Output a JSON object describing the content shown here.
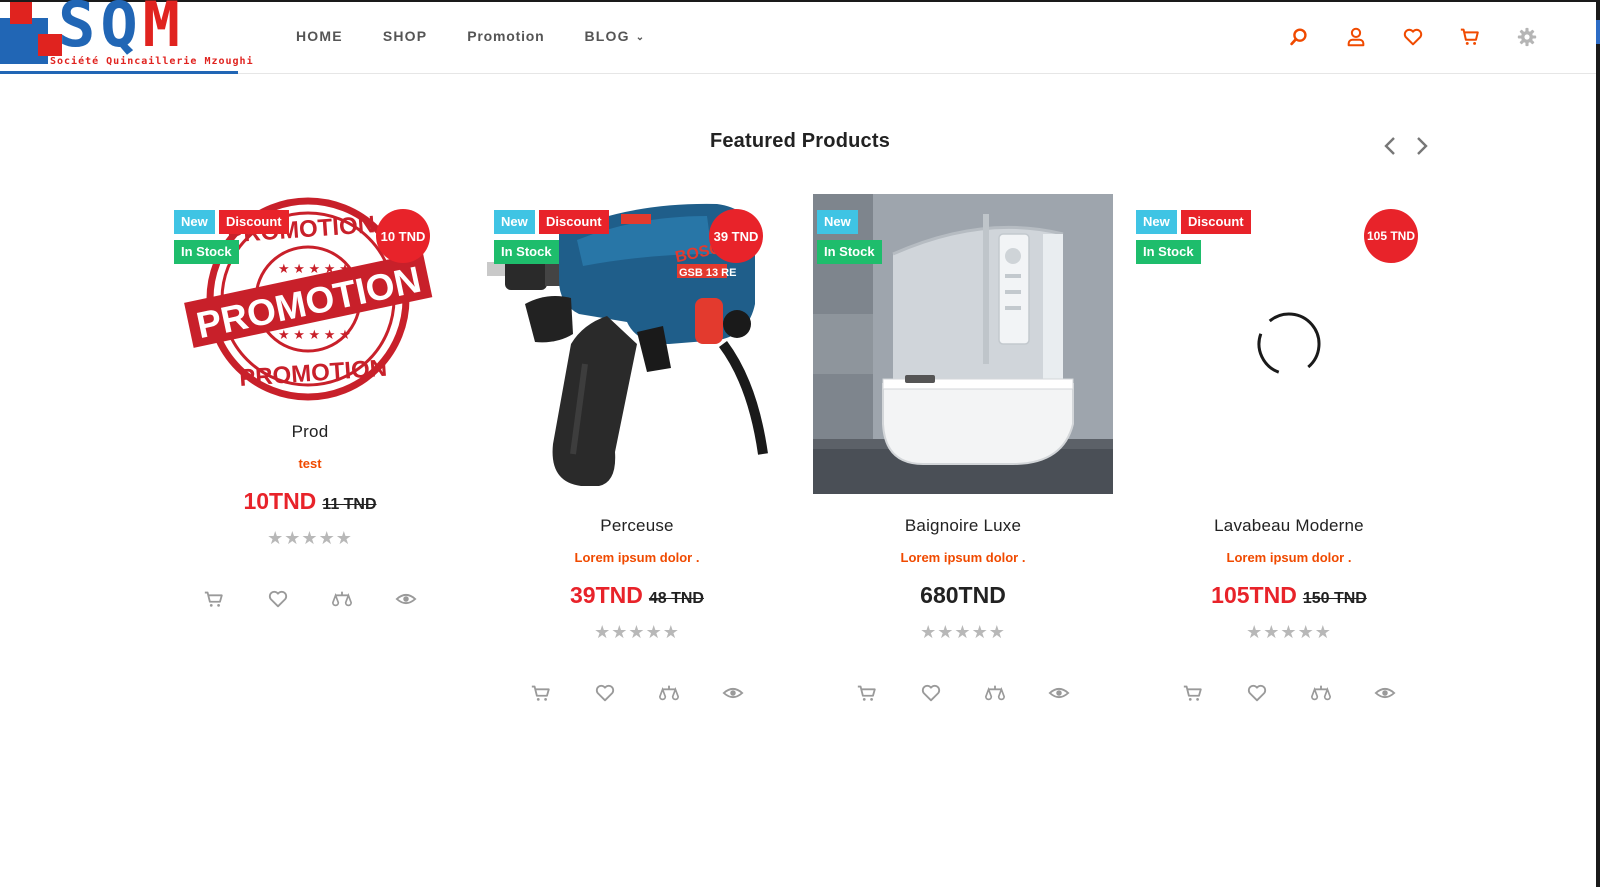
{
  "logo": {
    "text_left": "SQ",
    "text_right": "M",
    "subtitle": "Société Quincaillerie Mzoughi"
  },
  "nav": {
    "home": "HOME",
    "shop": "SHOP",
    "promotion": "Promotion",
    "blog": "BLOG"
  },
  "header_icons": [
    "search-icon",
    "user-icon",
    "heart-icon",
    "cart-icon",
    "gear-icon"
  ],
  "section": {
    "title": "Featured Products"
  },
  "products": [
    {
      "name": "Prod",
      "description": "test",
      "price": "10TND",
      "old_price": "11 TND",
      "price_badge": "10 TND",
      "badges": {
        "new": "New",
        "discount": "Discount",
        "stock": "In Stock"
      },
      "rating": "★★★★★",
      "image": "promotion-stamp",
      "stamp_text_top": "PROMOTION",
      "stamp_text_main": "PROMOTION",
      "stamp_text_bottom": "PROMOTION"
    },
    {
      "name": "Perceuse",
      "description": "Lorem ipsum dolor .",
      "price": "39TND",
      "old_price": "48 TND",
      "price_badge": "39 TND",
      "badges": {
        "new": "New",
        "discount": "Discount",
        "stock": "In Stock"
      },
      "rating": "★★★★★",
      "image": "drill",
      "drill_brand": "BOSCH",
      "drill_model": "GSB 13 RE"
    },
    {
      "name": "Baignoire Luxe",
      "description": "Lorem ipsum dolor .",
      "price": "680TND",
      "badges": {
        "new": "New",
        "stock": "In Stock"
      },
      "rating": "★★★★★",
      "image": "bathtub-shower"
    },
    {
      "name": "Lavabeau Moderne",
      "description": "Lorem ipsum dolor .",
      "price": "105TND",
      "old_price": "150 TND",
      "price_badge": "105 TND",
      "badges": {
        "new": "New",
        "discount": "Discount",
        "stock": "In Stock"
      },
      "rating": "★★★★★",
      "image": "loading-spinner"
    }
  ],
  "card_actions": [
    "cart-icon",
    "heart-icon",
    "compare-icon",
    "eye-icon"
  ],
  "colors": {
    "accent": "#f04a00",
    "sale_red": "#e8232a",
    "badge_new": "#3fc4e4",
    "badge_stock": "#1ebd6c",
    "logo_blue": "#2166b5",
    "logo_red": "#e0231f"
  }
}
